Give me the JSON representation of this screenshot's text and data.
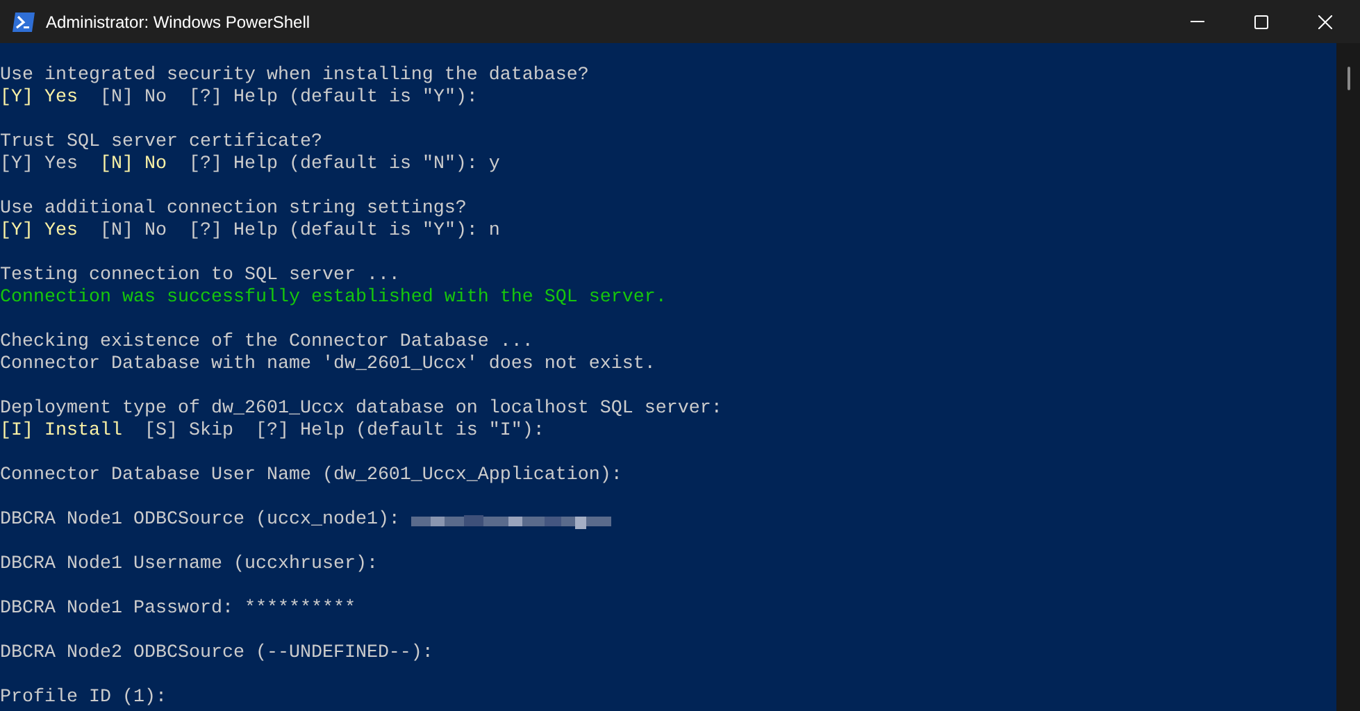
{
  "window": {
    "title": "Administrator: Windows PowerShell"
  },
  "console": {
    "blocks": [
      [
        {
          "segments": [
            {
              "kind": "plain",
              "text": "Use integrated security when installing the database?"
            }
          ]
        },
        {
          "segments": [
            {
              "kind": "highlight",
              "text": "[Y] Yes"
            },
            {
              "kind": "plain",
              "text": "  [N] No  [?] Help (default is \"Y\"):"
            }
          ]
        }
      ],
      [
        {
          "segments": [
            {
              "kind": "plain",
              "text": "Trust SQL server certificate?"
            }
          ]
        },
        {
          "segments": [
            {
              "kind": "plain",
              "text": "[Y] Yes  "
            },
            {
              "kind": "highlight",
              "text": "[N] No"
            },
            {
              "kind": "plain",
              "text": "  [?] Help (default is \"N\"): y"
            }
          ]
        }
      ],
      [
        {
          "segments": [
            {
              "kind": "plain",
              "text": "Use additional connection string settings?"
            }
          ]
        },
        {
          "segments": [
            {
              "kind": "highlight",
              "text": "[Y] Yes"
            },
            {
              "kind": "plain",
              "text": "  [N] No  [?] Help (default is \"Y\"): n"
            }
          ]
        }
      ],
      [
        {
          "segments": [
            {
              "kind": "plain",
              "text": "Testing connection to SQL server ..."
            }
          ]
        },
        {
          "segments": [
            {
              "kind": "success",
              "text": "Connection was successfully established with the SQL server."
            }
          ]
        }
      ],
      [
        {
          "segments": [
            {
              "kind": "plain",
              "text": "Checking existence of the Connector Database ..."
            }
          ]
        },
        {
          "segments": [
            {
              "kind": "plain",
              "text": "Connector Database with name 'dw_2601_Uccx' does not exist."
            }
          ]
        }
      ],
      [
        {
          "segments": [
            {
              "kind": "plain",
              "text": "Deployment type of dw_2601_Uccx database on localhost SQL server:"
            }
          ]
        },
        {
          "segments": [
            {
              "kind": "highlight",
              "text": "[I] Install"
            },
            {
              "kind": "plain",
              "text": "  [S] Skip  [?] Help (default is \"I\"):"
            }
          ]
        }
      ],
      [
        {
          "segments": [
            {
              "kind": "plain",
              "text": "Connector Database User Name (dw_2601_Uccx_Application):"
            }
          ]
        }
      ],
      [
        {
          "segments": [
            {
              "kind": "plain",
              "text": "DBCRA Node1 ODBCSource (uccx_node1): "
            },
            {
              "kind": "redacted"
            }
          ]
        }
      ],
      [
        {
          "segments": [
            {
              "kind": "plain",
              "text": "DBCRA Node1 Username (uccxhruser):"
            }
          ]
        }
      ],
      [
        {
          "segments": [
            {
              "kind": "plain",
              "text": "DBCRA Node1 Password: **********"
            }
          ]
        }
      ],
      [
        {
          "segments": [
            {
              "kind": "plain",
              "text": "DBCRA Node2 ODBCSource (--UNDEFINED--):"
            }
          ]
        }
      ],
      [
        {
          "segments": [
            {
              "kind": "plain",
              "text": "Profile ID (1):"
            }
          ]
        }
      ]
    ]
  }
}
